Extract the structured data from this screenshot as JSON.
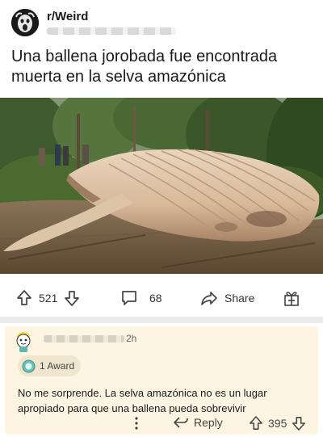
{
  "post": {
    "subreddit": "r/Weird",
    "title": "Una ballena jorobada fue encontrada muerta en la selva amazónica",
    "image_alt": "whale-in-jungle-photo",
    "upvotes": "521",
    "comments": "68",
    "share_label": "Share"
  },
  "comment": {
    "time": "2h",
    "award_label": "1 Award",
    "body": "No me sorprende. La selva amazónica no es un lugar apropiado para que una ballena pueda sobrevivir",
    "reply_label": "Reply",
    "score": "395"
  },
  "colors": {
    "comment_bg": "#fdf5e2",
    "separator": "#ececec",
    "text": "#1a1a1b"
  }
}
